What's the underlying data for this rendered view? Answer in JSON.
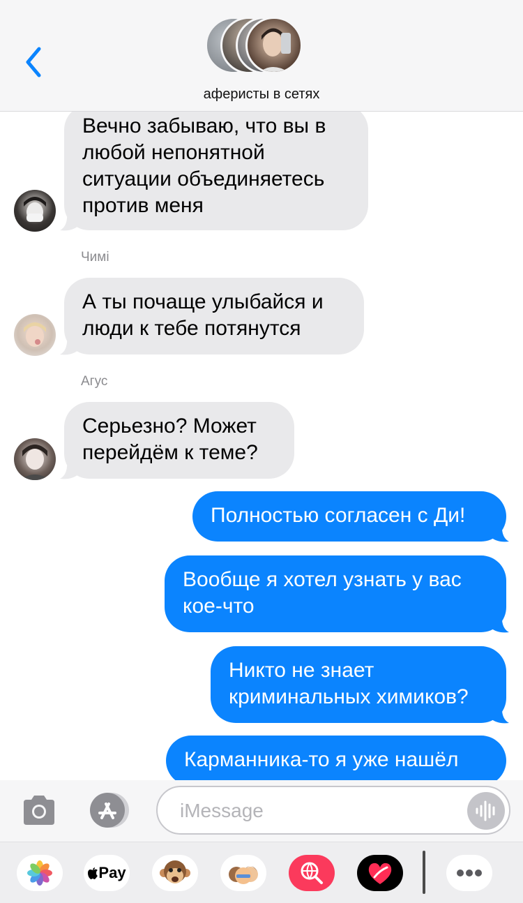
{
  "header": {
    "group_name": "аферисты в сетях",
    "back_icon": "chevron-left-icon",
    "accent": "#0b84fe"
  },
  "messages": {
    "m1": {
      "lines": [
        "Вечно забываю, что вы в",
        "любой непонятной",
        "ситуации объединяетесь",
        "против меня"
      ]
    },
    "m2": {
      "sender": "Чимі",
      "lines": [
        "А ты почаще улыбайся и",
        "люди к тебе потянутся"
      ]
    },
    "m3": {
      "sender": "Агус",
      "lines": [
        "Серьезно? Может",
        "перейдём к теме?"
      ]
    },
    "m4": {
      "lines": [
        "Полностью согласен с Ди!"
      ]
    },
    "m5": {
      "lines": [
        "Вообще я хотел узнать у вас",
        "кое-что"
      ]
    },
    "m6": {
      "lines": [
        "Никто не знает",
        "криминальных химиков?"
      ]
    },
    "m7": {
      "lines": [
        "Карманника-то я уже нашёл"
      ]
    }
  },
  "input": {
    "placeholder": "iMessage",
    "camera_icon": "camera-icon",
    "apps_icon": "app-store-icon",
    "voice_icon": "waveform-icon"
  },
  "apps": {
    "photos": "photos-icon",
    "pay_label": "Pay",
    "animoji": "monkey-animoji-icon",
    "memoji": "memoji-icon",
    "search": "globe-search-icon",
    "digital_touch": "heart-touch-icon",
    "more": "more-icon"
  },
  "colors": {
    "incoming_bubble": "#e9e9eb",
    "outgoing_bubble": "#0b84fe"
  }
}
